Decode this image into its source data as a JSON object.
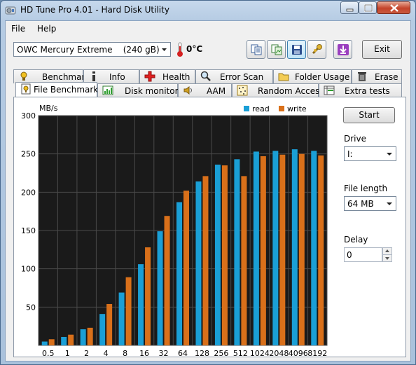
{
  "window": {
    "title": "HD Tune Pro 4.01 - Hard Disk Utility"
  },
  "menu": {
    "file": "File",
    "help": "Help"
  },
  "toolbar": {
    "drive": "OWC Mercury Extreme    (240 gB)",
    "temperature": "0°C",
    "exit_label": "Exit"
  },
  "tabs_row1": [
    "Benchmark",
    "Info",
    "Health",
    "Error Scan",
    "Folder Usage",
    "Erase"
  ],
  "tabs_row2": [
    "File Benchmark",
    "Disk monitor",
    "AAM",
    "Random Access",
    "Extra tests"
  ],
  "active_tab": "File Benchmark",
  "side": {
    "start_label": "Start",
    "drive_label": "Drive",
    "drive_value": "I:",
    "file_length_label": "File length",
    "file_length_value": "64 MB",
    "delay_label": "Delay",
    "delay_value": "0"
  },
  "chart_data": {
    "type": "bar",
    "ylabel": "MB/s",
    "ylim": [
      0,
      300
    ],
    "yticks": [
      50,
      100,
      150,
      200,
      250,
      300
    ],
    "categories": [
      "0.5",
      "1",
      "2",
      "4",
      "8",
      "16",
      "32",
      "64",
      "128",
      "256",
      "512",
      "1024",
      "2048",
      "4096",
      "8192"
    ],
    "series": [
      {
        "name": "read",
        "color": "#1a9fd6",
        "values": [
          5,
          11,
          21,
          41,
          69,
          106,
          149,
          187,
          214,
          236,
          243,
          253,
          254,
          256,
          254
        ]
      },
      {
        "name": "write",
        "color": "#d9701a",
        "values": [
          8,
          14,
          23,
          54,
          89,
          128,
          169,
          202,
          221,
          235,
          221,
          247,
          249,
          250,
          248
        ]
      }
    ],
    "legend_position": "top-right",
    "grid": true,
    "background": "#1a1a1a"
  }
}
